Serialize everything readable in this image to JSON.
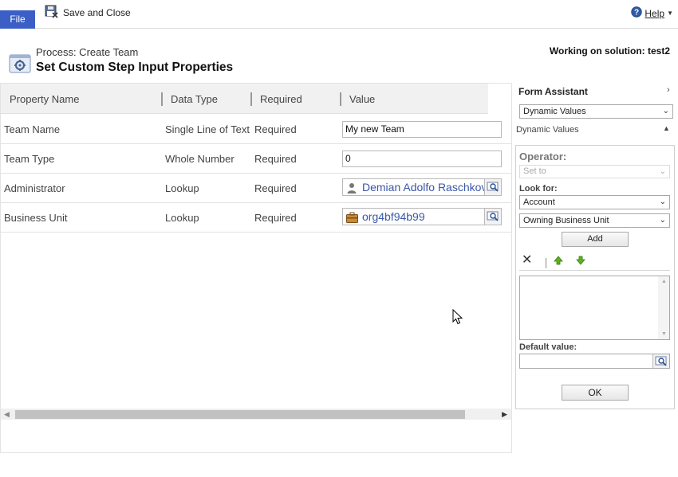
{
  "ribbon": {
    "file_label": "File",
    "save_close_label": "Save and Close",
    "help_label": "Help"
  },
  "header": {
    "process_line": "Process: Create Team",
    "title": "Set Custom Step Input Properties",
    "solution": "Working on solution: test2"
  },
  "grid": {
    "columns": [
      "Property Name",
      "Data Type",
      "Required",
      "Value"
    ],
    "rows": [
      {
        "name": "Team Name",
        "type": "Single Line of Text",
        "required": "Required",
        "value": "My new Team",
        "kind": "text"
      },
      {
        "name": "Team Type",
        "type": "Whole Number",
        "required": "Required",
        "value": "0",
        "kind": "text"
      },
      {
        "name": "Administrator",
        "type": "Lookup",
        "required": "Required",
        "value": "Demian Adolfo Raschkovan",
        "kind": "lookup-user"
      },
      {
        "name": "Business Unit",
        "type": "Lookup",
        "required": "Required",
        "value": "org4bf94b99",
        "kind": "lookup-bu"
      }
    ]
  },
  "form_assistant": {
    "title": "Form Assistant",
    "top_select": "Dynamic Values",
    "section_label": "Dynamic Values",
    "operator_label": "Operator:",
    "operator_value": "Set to",
    "look_for_label": "Look for:",
    "look_for_value": "Account",
    "attribute_value": "Owning Business Unit",
    "add_label": "Add",
    "default_label": "Default value:",
    "ok_label": "OK"
  },
  "icons": {
    "save": "save-close-icon",
    "help": "help-icon",
    "process": "process-gear-icon",
    "user": "user-icon",
    "business_unit": "business-unit-icon",
    "lookup": "lookup-search-icon"
  },
  "colors": {
    "file_tab": "#3b5fc6",
    "link": "#3a57a8"
  }
}
